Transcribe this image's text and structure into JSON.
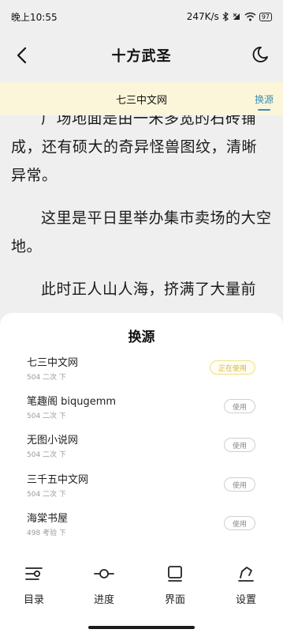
{
  "status_bar": {
    "time": "晚上10:55",
    "network_speed": "247K/s",
    "battery": "97"
  },
  "app_bar": {
    "title": "十方武圣"
  },
  "source_bar": {
    "current_source": "七三中文网",
    "switch_label": "换源"
  },
  "reader": {
    "paragraphs": [
      "广场地面是由一米多宽的石砖铺成，还有硕大的奇异怪兽图纹，清晰异常。",
      "这里是平日里举办集市卖场的大空地。",
      "此时正人山人海，挤满了大量前"
    ]
  },
  "source_sheet": {
    "title": "换源",
    "items": [
      {
        "name": "七三中文网",
        "meta": "504 二次 下",
        "button": "正在使用",
        "active": true
      },
      {
        "name": "笔趣阁 biqugemm",
        "meta": "504 二次 下",
        "button": "使用",
        "active": false
      },
      {
        "name": "无图小说网",
        "meta": "504 二次 下",
        "button": "使用",
        "active": false
      },
      {
        "name": "三千五中文网",
        "meta": "504 二次 下",
        "button": "使用",
        "active": false
      },
      {
        "name": "海棠书屋",
        "meta": "498 考验 下",
        "button": "使用",
        "active": false
      }
    ]
  },
  "bottom_nav": {
    "items": [
      {
        "label": "目录",
        "icon": "catalog-icon"
      },
      {
        "label": "进度",
        "icon": "progress-icon"
      },
      {
        "label": "界面",
        "icon": "display-icon"
      },
      {
        "label": "设置",
        "icon": "settings-icon"
      }
    ]
  },
  "colors": {
    "accent": "#3d8fb5",
    "source_bar_bg": "#fbf6d9",
    "active_badge": "#d4b53e"
  }
}
